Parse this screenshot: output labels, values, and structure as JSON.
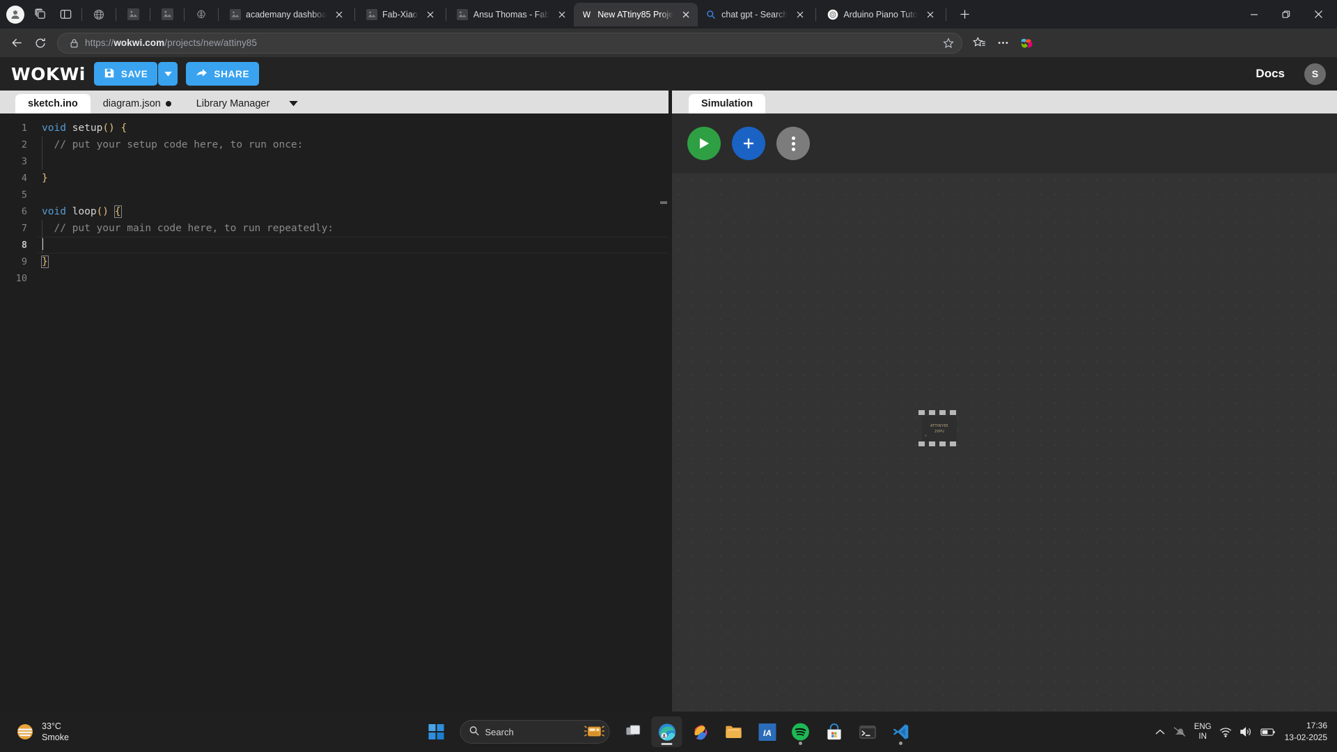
{
  "browser": {
    "tabstrip_icons": [
      "profile-avatar-icon",
      "tab-groups-icon",
      "split-screen-icon"
    ],
    "pinned_tabs": [
      "globe-icon",
      "image-icon",
      "image-icon",
      "brain-icon"
    ],
    "tabs": [
      {
        "label": "academany dashboard",
        "favicon": "image-icon",
        "active": false
      },
      {
        "label": "Fab-Xiao",
        "favicon": "image-icon",
        "active": false
      },
      {
        "label": "Ansu Thomas - Fab",
        "favicon": "image-icon",
        "active": false
      },
      {
        "label": "New ATtiny85 Proje",
        "favicon": "wokwi-icon",
        "active": true
      },
      {
        "label": "chat gpt - Search",
        "favicon": "bing-search-icon",
        "active": false
      },
      {
        "label": "Arduino Piano Tuto",
        "favicon": "chatgpt-icon",
        "active": false
      }
    ],
    "new_tab_tooltip": "New tab",
    "window_controls": [
      "minimize",
      "maximize",
      "close"
    ],
    "nav": {
      "back": "back-arrow",
      "reload": "reload-icon",
      "url_scheme": "https://",
      "url_domain": "wokwi.com",
      "url_path": "/projects/new/attiny85",
      "favorite": "star-icon",
      "collections": "collections-icon",
      "settings": "more-settings-icon",
      "copilot": "copilot-icon"
    }
  },
  "wokwi": {
    "logo": "WOKWi",
    "save_label": "SAVE",
    "share_label": "SHARE",
    "docs_label": "Docs",
    "user_initial": "S",
    "accent_blue": "#3aa3f0",
    "editor_tabs": [
      {
        "label": "sketch.ino",
        "active": true,
        "dirty": false
      },
      {
        "label": "diagram.json",
        "active": false,
        "dirty": true
      },
      {
        "label": "Library Manager",
        "active": false,
        "dirty": false
      }
    ],
    "code": {
      "line_numbers": [
        "1",
        "2",
        "3",
        "4",
        "5",
        "6",
        "7",
        "8",
        "9",
        "10"
      ],
      "current_line": 8,
      "lines": [
        "void setup() {",
        "  // put your setup code here, to run once:",
        "",
        "}",
        "",
        "void loop() {",
        "  // put your main code here, to run repeatedly:",
        "",
        "}",
        ""
      ]
    },
    "simulation": {
      "tab_label": "Simulation",
      "play_button": "play-icon",
      "add_button": "plus-icon",
      "menu_button": "kebab-menu-icon",
      "chip": {
        "line1": "ATTINY85",
        "line2": "20PU"
      }
    }
  },
  "taskbar": {
    "weather": {
      "temperature": "33°C",
      "condition": "Smoke",
      "icon": "smoke-weather-icon"
    },
    "start_icon": "windows-start-icon",
    "search_placeholder": "Search",
    "search_widget_icon": "radio-widget-icon",
    "apps": [
      {
        "name": "task-view",
        "running": false
      },
      {
        "name": "microsoft-edge",
        "running": true,
        "active": true
      },
      {
        "name": "microsoft-office",
        "running": false
      },
      {
        "name": "file-explorer",
        "running": false
      },
      {
        "name": "autodesk-app",
        "running": false
      },
      {
        "name": "spotify",
        "running": true
      },
      {
        "name": "microsoft-store",
        "running": false
      },
      {
        "name": "terminal",
        "running": false
      },
      {
        "name": "visual-studio-code",
        "running": true
      }
    ],
    "tray": {
      "overflow": "chevron-up-icon",
      "notification": "muted-notification-icon",
      "language": "ENG",
      "region": "IN",
      "wifi": "wifi-icon",
      "volume": "speaker-icon",
      "battery": "battery-icon",
      "time": "17:36",
      "date": "13-02-2025"
    }
  }
}
